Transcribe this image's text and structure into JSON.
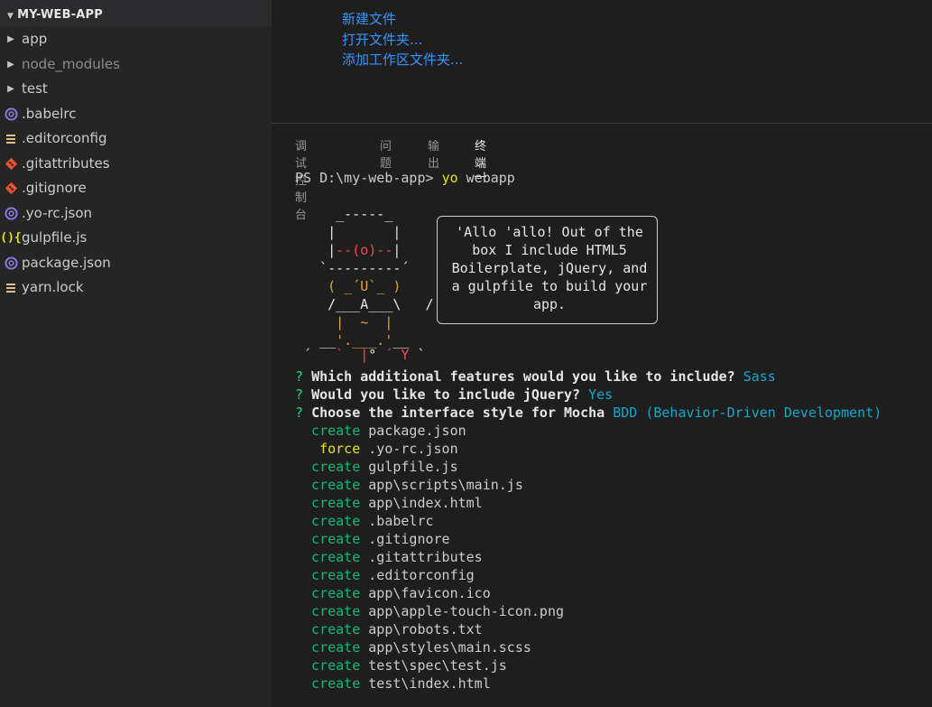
{
  "sidebar": {
    "title": "MY-WEB-APP",
    "items": [
      {
        "label": "app",
        "type": "folder"
      },
      {
        "label": "node_modules",
        "type": "folder"
      },
      {
        "label": "test",
        "type": "folder"
      },
      {
        "label": ".babelrc",
        "type": "file",
        "icon": "babel-icon"
      },
      {
        "label": ".editorconfig",
        "type": "file",
        "icon": "config-lines-icon"
      },
      {
        "label": ".gitattributes",
        "type": "file",
        "icon": "git-icon"
      },
      {
        "label": ".gitignore",
        "type": "file",
        "icon": "git-icon"
      },
      {
        "label": ".yo-rc.json",
        "type": "file",
        "icon": "json-icon"
      },
      {
        "label": "gulpfile.js",
        "type": "file",
        "icon": "js-icon"
      },
      {
        "label": "package.json",
        "type": "file",
        "icon": "json-icon"
      },
      {
        "label": "yarn.lock",
        "type": "file",
        "icon": "config-lines-icon"
      }
    ]
  },
  "welcome": {
    "links": [
      "新建文件",
      "打开文件夹...",
      "添加工作区文件夹..."
    ]
  },
  "panel": {
    "tabs": [
      "调试控制台",
      "问题",
      "输出",
      "终端"
    ],
    "active_tab": "终端"
  },
  "terminal": {
    "prompt": "PS D:\\my-web-app> ",
    "command_yo": "yo",
    "command_rest": " webapp",
    "ascii": {
      "l1": "     _-----_",
      "l2": "    |       |",
      "l3_a": "    |",
      "l3_b": "--(o)--",
      "l3_c": "|",
      "l4": "   `---------´",
      "l5_a": "    ",
      "l5_b": "( _´U`_ )",
      "l6_a": "    ",
      "l6_b": "/___A___\\",
      "l6_c": "   /",
      "l7_a": "     ",
      "l7_b": "|  ~  |",
      "l8_a": "   __",
      "l8_b": "'.___.'",
      "l8_c": "__",
      "l9_a": " ´   ",
      "l9_b": "`  |",
      "l9_c": "° ",
      "l9_d": "´ Y",
      "l9_e": " `"
    },
    "bubble_text": "'Allo 'allo! Out of the box I include HTML5 Boilerplate, jQuery, and a gulpfile to build your app.",
    "questions": [
      {
        "mark": "?",
        "text": "Which additional features would you like to include?",
        "answer": "Sass"
      },
      {
        "mark": "?",
        "text": "Would you like to include jQuery?",
        "answer": "Yes"
      },
      {
        "mark": "?",
        "text": "Choose the interface style for Mocha",
        "answer": "BDD (Behavior-Driven Development)"
      }
    ],
    "files": [
      {
        "verb": "create",
        "path": "package.json"
      },
      {
        "verb": "force",
        "path": ".yo-rc.json"
      },
      {
        "verb": "create",
        "path": "gulpfile.js"
      },
      {
        "verb": "create",
        "path": "app\\scripts\\main.js"
      },
      {
        "verb": "create",
        "path": "app\\index.html"
      },
      {
        "verb": "create",
        "path": ".babelrc"
      },
      {
        "verb": "create",
        "path": ".gitignore"
      },
      {
        "verb": "create",
        "path": ".gitattributes"
      },
      {
        "verb": "create",
        "path": ".editorconfig"
      },
      {
        "verb": "create",
        "path": "app\\favicon.ico"
      },
      {
        "verb": "create",
        "path": "app\\apple-touch-icon.png"
      },
      {
        "verb": "create",
        "path": "app\\robots.txt"
      },
      {
        "verb": "create",
        "path": "app\\styles\\main.scss"
      },
      {
        "verb": "create",
        "path": "test\\spec\\test.js"
      },
      {
        "verb": "create",
        "path": "test\\index.html"
      }
    ]
  },
  "colors": {
    "accent_link": "#3794ff",
    "terminal_green": "#23d18b",
    "terminal_cyan": "#11a8cd",
    "terminal_yellow": "#e5e510"
  }
}
